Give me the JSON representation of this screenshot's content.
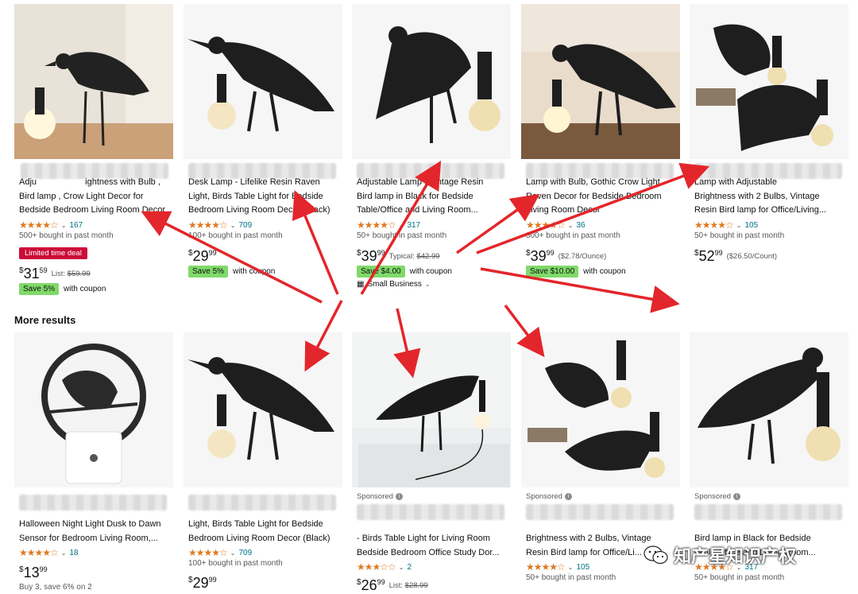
{
  "section_title": "More results",
  "row1": [
    {
      "title": "Adju   Brightness with Bulb , Bird lamp , Crow Light Decor for Bedside Bedroom Living Room Decor",
      "title_lines": [
        "Adju                    ightness with Bulb ,",
        "Bird lamp , Crow Light Decor for",
        "Bedside Bedroom Living Room Decor"
      ],
      "stars": "★★★★☆",
      "rating_count": "167",
      "bought": "500+ bought in past month",
      "deal": "Limited time deal",
      "price_whole": "31",
      "price_frac": "59",
      "price_note": "List: ",
      "price_strike": "$59.99",
      "coupon_badge": "Save 5%",
      "coupon_text": "with coupon"
    },
    {
      "title_lines": [
        "Desk Lamp - Lifelike Resin Raven",
        "Light, Birds Table Light for Bedside",
        "Bedroom Living Room Decor (Black)"
      ],
      "stars": "★★★★☆",
      "rating_count": "709",
      "bought": "100+ bought in past month",
      "price_whole": "29",
      "price_frac": "99",
      "coupon_badge": "Save 5%",
      "coupon_text": "with coupon"
    },
    {
      "title_lines": [
        "Adjustable Lamp , Vintage Resin",
        "Bird lamp in Black for Bedside",
        "Table/Office and Living Room..."
      ],
      "stars": "★★★★☆",
      "rating_count": "317",
      "bought": "50+ bought in past month",
      "price_whole": "39",
      "price_frac": "99",
      "price_note": "Typical: ",
      "price_strike": "$42.99",
      "coupon_badge": "Save $4.00",
      "coupon_text": "with coupon",
      "small_business": "Small Business"
    },
    {
      "title_lines": [
        "Lamp with Bulb, Gothic Crow Light",
        "Raven Decor for Bedside Bedroom",
        "Living Room Decor"
      ],
      "stars": "★★★★☆",
      "rating_count": "36",
      "bought": "300+ bought in past month",
      "price_whole": "39",
      "price_frac": "99",
      "price_note": "($2.78/Ounce)",
      "coupon_badge": "Save $10.00",
      "coupon_text": "with coupon"
    },
    {
      "title_lines": [
        "Lamp with Adjustable",
        "Brightness with 2 Bulbs, Vintage",
        "Resin Bird lamp for Office/Living..."
      ],
      "stars": "★★★★☆",
      "rating_count": "105",
      "bought": "50+ bought in past month",
      "price_whole": "52",
      "price_frac": "99",
      "price_note": "($26.50/Count)"
    }
  ],
  "row2": [
    {
      "title_lines": [
        "Halloween Night Light Dusk to Dawn",
        "Sensor for Bedroom Living Room,..."
      ],
      "stars": "★★★★☆",
      "rating_count": "18",
      "price_whole": "13",
      "price_frac": "99",
      "extra": "Buy 3, save 6% on 2"
    },
    {
      "title_lines": [
        "Light, Birds Table Light for Bedside",
        "Bedroom Living Room Decor (Black)"
      ],
      "stars": "★★★★☆",
      "rating_count": "709",
      "bought": "100+ bought in past month",
      "price_whole": "29",
      "price_frac": "99"
    },
    {
      "sponsored": "Sponsored",
      "title_lines": [
        "- Birds Table Light for Living Room",
        "Bedside Bedroom Office Study Dor..."
      ],
      "stars": "★★★☆☆",
      "rating_count": "2",
      "price_whole": "26",
      "price_frac": "99",
      "price_note": "List: ",
      "price_strike": "$28.99"
    },
    {
      "sponsored": "Sponsored",
      "title_lines": [
        "Brightness with 2 Bulbs, Vintage",
        "Resin Bird lamp for Office/Li..."
      ],
      "stars": "★★★★☆",
      "rating_count": "105",
      "bought": "50+ bought in past month"
    },
    {
      "sponsored": "Sponsored",
      "title_lines": [
        "Bird lamp in Black for Bedside",
        "Table/Office and Living Room..."
      ],
      "stars": "★★★★☆",
      "rating_count": "317",
      "bought": "50+ bought in past month"
    }
  ],
  "currency": "$",
  "watermark": "知产星知识产权",
  "colors": {
    "star": "#de7921",
    "link": "#007185",
    "deal": "#cc0c39",
    "coupon": "#7fda69",
    "arrow": "#e3262b"
  },
  "icons": [
    "crow-lamp-image",
    "info-icon",
    "store-icon",
    "chevron-down-icon",
    "wechat-icon"
  ]
}
